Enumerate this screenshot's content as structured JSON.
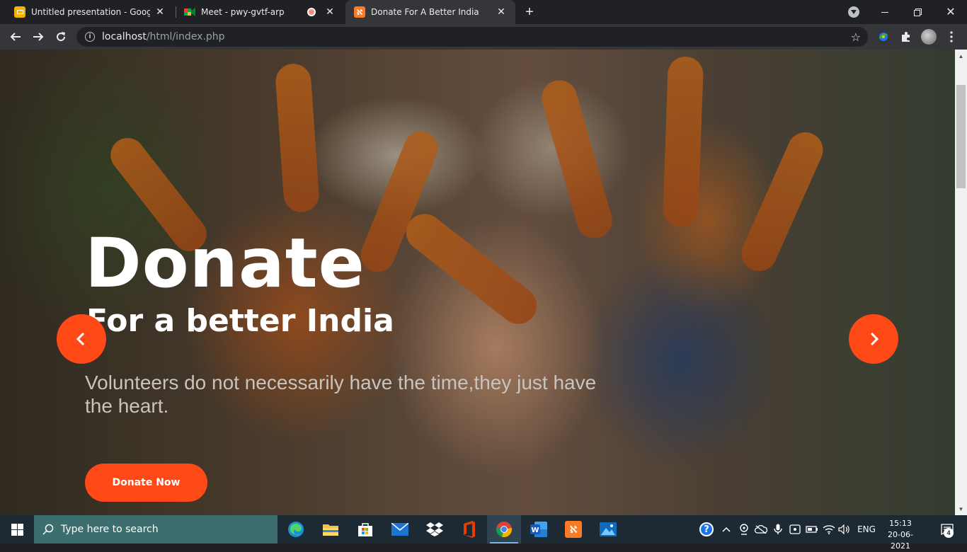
{
  "browser": {
    "tabs": [
      {
        "title": "Untitled presentation - Google Sl",
        "favicon": "google-slides-icon",
        "active": false
      },
      {
        "title": "Meet - pwy-gvtf-arp",
        "favicon": "google-meet-icon",
        "active": false,
        "recording": true
      },
      {
        "title": "Donate For A Better India",
        "favicon": "xampp-icon",
        "active": true
      }
    ],
    "address_bar": {
      "host": "localhost",
      "path": "/html/index.php"
    }
  },
  "page": {
    "hero": {
      "title": "Donate",
      "subtitle": "For a better India",
      "quote": "Volunteers do not necessarily have the time,they just have the heart.",
      "cta_label": "Donate Now"
    },
    "colors": {
      "accent": "#ff4a17",
      "title_text": "#ffffff",
      "quote_text": "#c8c3bd"
    }
  },
  "taskbar": {
    "search_placeholder": "Type here to search",
    "apps": [
      "edge-icon",
      "file-explorer-icon",
      "store-icon",
      "mail-icon",
      "dropbox-icon",
      "office-icon",
      "chrome-icon",
      "word-icon",
      "xampp-icon",
      "photos-icon"
    ],
    "language": "ENG",
    "time": "15:13",
    "date": "20-06-2021",
    "notification_count": "4"
  }
}
